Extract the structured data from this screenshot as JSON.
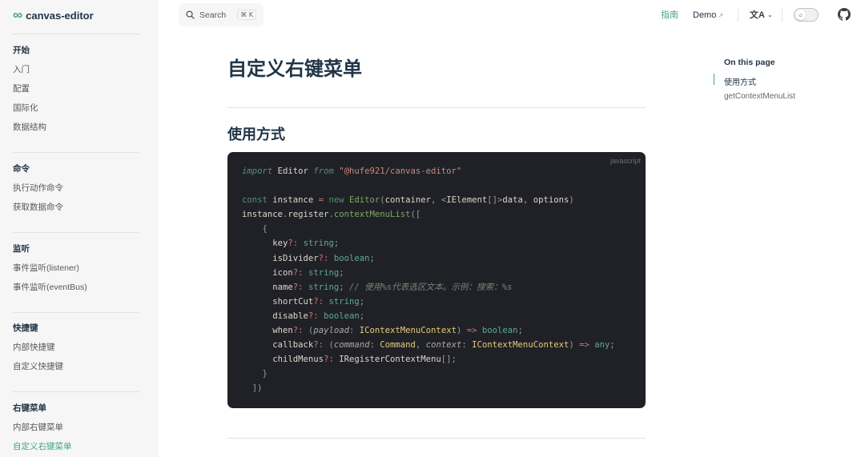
{
  "app": {
    "logo_glyph": "∞",
    "title": "canvas-editor"
  },
  "search": {
    "label": "Search",
    "shortcut": "⌘ K"
  },
  "nav": {
    "guide": "指南",
    "demo": "Demo",
    "demo_ext": "↗",
    "lang_glyph": "文A",
    "chevron": "⌄",
    "theme_glyph": "☼",
    "accent_color": "#3fa67f"
  },
  "sidebar": {
    "groups": [
      {
        "title": "开始",
        "items": [
          "入门",
          "配置",
          "国际化",
          "数据结构"
        ]
      },
      {
        "title": "命令",
        "items": [
          "执行动作命令",
          "获取数据命令"
        ]
      },
      {
        "title": "监听",
        "items": [
          "事件监听(listener)",
          "事件监听(eventBus)"
        ]
      },
      {
        "title": "快捷键",
        "items": [
          "内部快捷键",
          "自定义快捷键"
        ]
      },
      {
        "title": "右键菜单",
        "items": [
          "内部右键菜单",
          "自定义右键菜单"
        ]
      }
    ],
    "active_item": "自定义右键菜单"
  },
  "main": {
    "page_title": "自定义右键菜单",
    "section_title": "使用方式",
    "code_language": "javascript",
    "next_section_peek": "getContextMenuList"
  },
  "outline": {
    "title": "On this page",
    "items": [
      "使用方式",
      "getContextMenuList"
    ],
    "active": "使用方式"
  },
  "icons": {
    "search": "search-icon",
    "external": "external-link-icon",
    "translate": "translate-icon",
    "theme": "sun-icon",
    "github": "github-icon"
  }
}
